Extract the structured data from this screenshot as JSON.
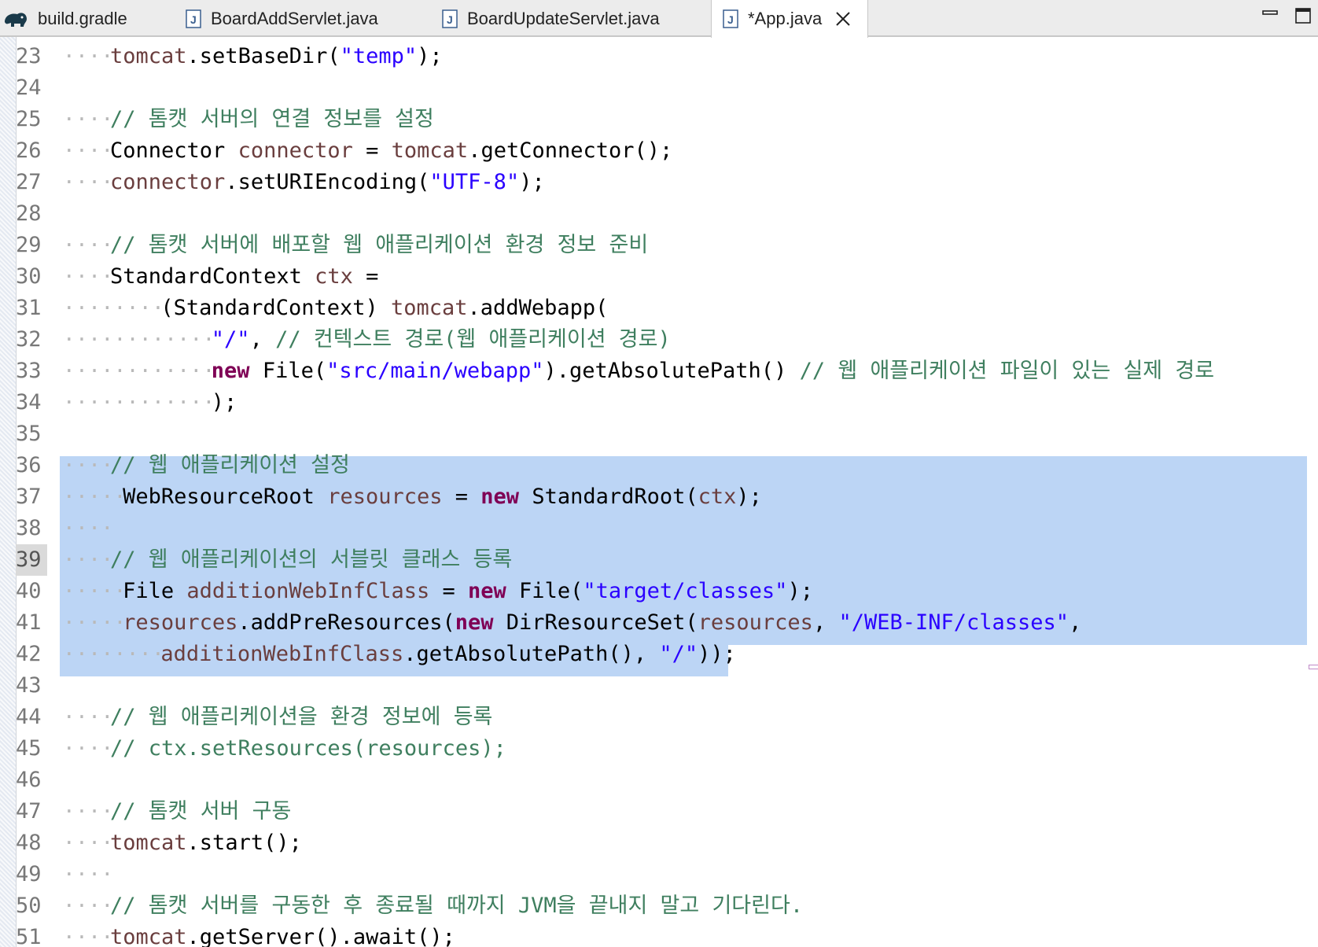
{
  "tabs": [
    {
      "label": "build.gradle",
      "icon": "gradle-elephant-icon",
      "active": false
    },
    {
      "label": "BoardAddServlet.java",
      "icon": "java-file-icon",
      "active": false
    },
    {
      "label": "BoardUpdateServlet.java",
      "icon": "java-file-icon",
      "active": false
    },
    {
      "label": "*App.java",
      "icon": "java-file-icon",
      "active": true
    }
  ],
  "window_controls": {
    "minimize_icon": "minimize-icon",
    "maximize_icon": "maximize-icon"
  },
  "colors": {
    "keyword": "#7f0055",
    "string": "#2a00ff",
    "comment": "#3f7f5f",
    "variable": "#6a3e3e",
    "selection": "#bcd5f5",
    "line_number": "#787878"
  },
  "editor": {
    "current_line": 39,
    "selection_lines": [
      36,
      42
    ],
    "lines": [
      {
        "n": "23",
        "tokens": [
          [
            "var",
            "tomcat"
          ],
          [
            "plain",
            ".setBaseDir("
          ],
          [
            "str",
            "\"temp\""
          ],
          [
            "plain",
            ");"
          ]
        ]
      },
      {
        "n": "24",
        "tokens": []
      },
      {
        "n": "25",
        "tokens": [
          [
            "com",
            "// 톰캣 서버의 연결 정보를 설정"
          ]
        ]
      },
      {
        "n": "26",
        "tokens": [
          [
            "plain",
            "Connector "
          ],
          [
            "var",
            "connector"
          ],
          [
            "plain",
            " = "
          ],
          [
            "var",
            "tomcat"
          ],
          [
            "plain",
            ".getConnector();"
          ]
        ]
      },
      {
        "n": "27",
        "tokens": [
          [
            "var",
            "connector"
          ],
          [
            "plain",
            ".setURIEncoding("
          ],
          [
            "str",
            "\"UTF-8\""
          ],
          [
            "plain",
            ");"
          ]
        ]
      },
      {
        "n": "28",
        "tokens": []
      },
      {
        "n": "29",
        "tokens": [
          [
            "com",
            "// 톰캣 서버에 배포할 웹 애플리케이션 환경 정보 준비"
          ]
        ]
      },
      {
        "n": "30",
        "tokens": [
          [
            "plain",
            "StandardContext "
          ],
          [
            "var",
            "ctx"
          ],
          [
            "plain",
            " ="
          ]
        ]
      },
      {
        "n": "31",
        "tokens": [
          [
            "plain",
            "(StandardContext) "
          ],
          [
            "var",
            "tomcat"
          ],
          [
            "plain",
            ".addWebapp("
          ]
        ]
      },
      {
        "n": "32",
        "tokens": [
          [
            "str",
            "\"/\""
          ],
          [
            "plain",
            ", "
          ],
          [
            "com",
            "// 컨텍스트 경로(웹 애플리케이션 경로)"
          ]
        ]
      },
      {
        "n": "33",
        "tokens": [
          [
            "kw",
            "new"
          ],
          [
            "plain",
            " File("
          ],
          [
            "str",
            "\"src/main/webapp\""
          ],
          [
            "plain",
            ").getAbsolutePath() "
          ],
          [
            "com",
            "// 웹 애플리케이션 파일이 있는 실제 경로"
          ]
        ]
      },
      {
        "n": "34",
        "tokens": [
          [
            "plain",
            ");"
          ]
        ]
      },
      {
        "n": "35",
        "tokens": []
      },
      {
        "n": "36",
        "tokens": [
          [
            "com",
            "// 웹 애플리케이션 설정"
          ]
        ]
      },
      {
        "n": "37",
        "tokens": [
          [
            "plain",
            "WebResourceRoot "
          ],
          [
            "var",
            "resources"
          ],
          [
            "plain",
            " = "
          ],
          [
            "kw",
            "new"
          ],
          [
            "plain",
            " StandardRoot("
          ],
          [
            "var",
            "ctx"
          ],
          [
            "plain",
            ");"
          ]
        ]
      },
      {
        "n": "38",
        "tokens": []
      },
      {
        "n": "39",
        "tokens": [
          [
            "com",
            "// 웹 애플리케이션의 서블릿 클래스 등록"
          ]
        ]
      },
      {
        "n": "40",
        "tokens": [
          [
            "plain",
            "File "
          ],
          [
            "var",
            "additionWebInfClass"
          ],
          [
            "plain",
            " = "
          ],
          [
            "kw",
            "new"
          ],
          [
            "plain",
            " File("
          ],
          [
            "str",
            "\"target/classes\""
          ],
          [
            "plain",
            ");"
          ]
        ]
      },
      {
        "n": "41",
        "tokens": [
          [
            "var",
            "resources"
          ],
          [
            "plain",
            ".addPreResources("
          ],
          [
            "kw",
            "new"
          ],
          [
            "plain",
            " DirResourceSet("
          ],
          [
            "var",
            "resources"
          ],
          [
            "plain",
            ", "
          ],
          [
            "str",
            "\"/WEB-INF/classes\""
          ],
          [
            "plain",
            ","
          ]
        ]
      },
      {
        "n": "42",
        "tokens": [
          [
            "var",
            "additionWebInfClass"
          ],
          [
            "plain",
            ".getAbsolutePath(), "
          ],
          [
            "str",
            "\"/\""
          ],
          [
            "plain",
            "));"
          ]
        ]
      },
      {
        "n": "43",
        "tokens": []
      },
      {
        "n": "44",
        "tokens": [
          [
            "com",
            "// 웹 애플리케이션을 환경 정보에 등록"
          ]
        ]
      },
      {
        "n": "45",
        "tokens": [
          [
            "com",
            "// ctx.setResources(resources);"
          ]
        ]
      },
      {
        "n": "46",
        "tokens": []
      },
      {
        "n": "47",
        "tokens": [
          [
            "com",
            "// 톰캣 서버 구동"
          ]
        ]
      },
      {
        "n": "48",
        "tokens": [
          [
            "var",
            "tomcat"
          ],
          [
            "plain",
            ".start();"
          ]
        ]
      },
      {
        "n": "49",
        "tokens": []
      },
      {
        "n": "50",
        "tokens": [
          [
            "com",
            "// 톰캣 서버를 구동한 후 종료될 때까지 JVM을 끝내지 말고 기다린다."
          ]
        ]
      },
      {
        "n": "51",
        "tokens": [
          [
            "var",
            "tomcat"
          ],
          [
            "plain",
            ".getServer().await();"
          ]
        ]
      }
    ]
  }
}
